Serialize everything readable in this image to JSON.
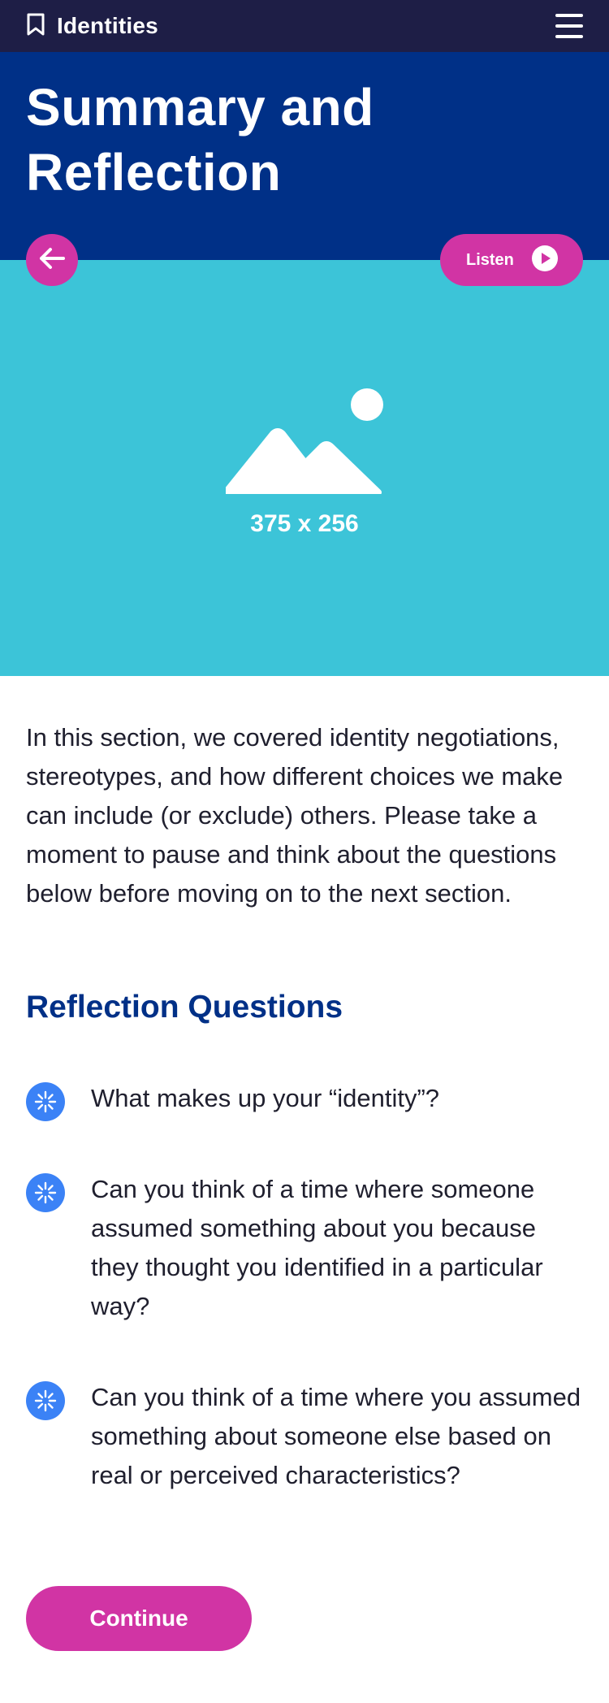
{
  "header": {
    "app_title": "Identities",
    "bookmark_icon": "bookmark-icon",
    "menu_icon": "hamburger-menu-icon",
    "background": "#1e1e46"
  },
  "hero": {
    "title_line1": "Summary and",
    "title_line2": "Reflection",
    "background": "#003087"
  },
  "media": {
    "placeholder_label": "375 x 256",
    "placeholder_icon": "image-placeholder-icon",
    "background": "#3cc4d8"
  },
  "controls": {
    "back_icon": "arrow-left-icon",
    "listen_label": "Listen",
    "play_icon": "play-circle-icon",
    "accent": "#d134a4"
  },
  "content": {
    "intro_text": "In this section, we covered identity negotiations, stereotypes, and how different choices we make can include (or exclude) others. Please take a moment to pause and think about the questions below before moving on to the next section.",
    "section_title": "Reflection Questions",
    "questions": [
      {
        "text": "What makes up your “identity”?",
        "icon": "sparkle-icon"
      },
      {
        "text": "Can you think of a time where someone assumed something about you because they thought you identified in a particular way?",
        "icon": "sparkle-icon"
      },
      {
        "text": "Can you think of a time where you assumed something about someone else based on real or perceived characteristics?",
        "icon": "sparkle-icon"
      }
    ],
    "question_icon_color": "#3b82f6"
  },
  "footer": {
    "continue_label": "Continue"
  }
}
